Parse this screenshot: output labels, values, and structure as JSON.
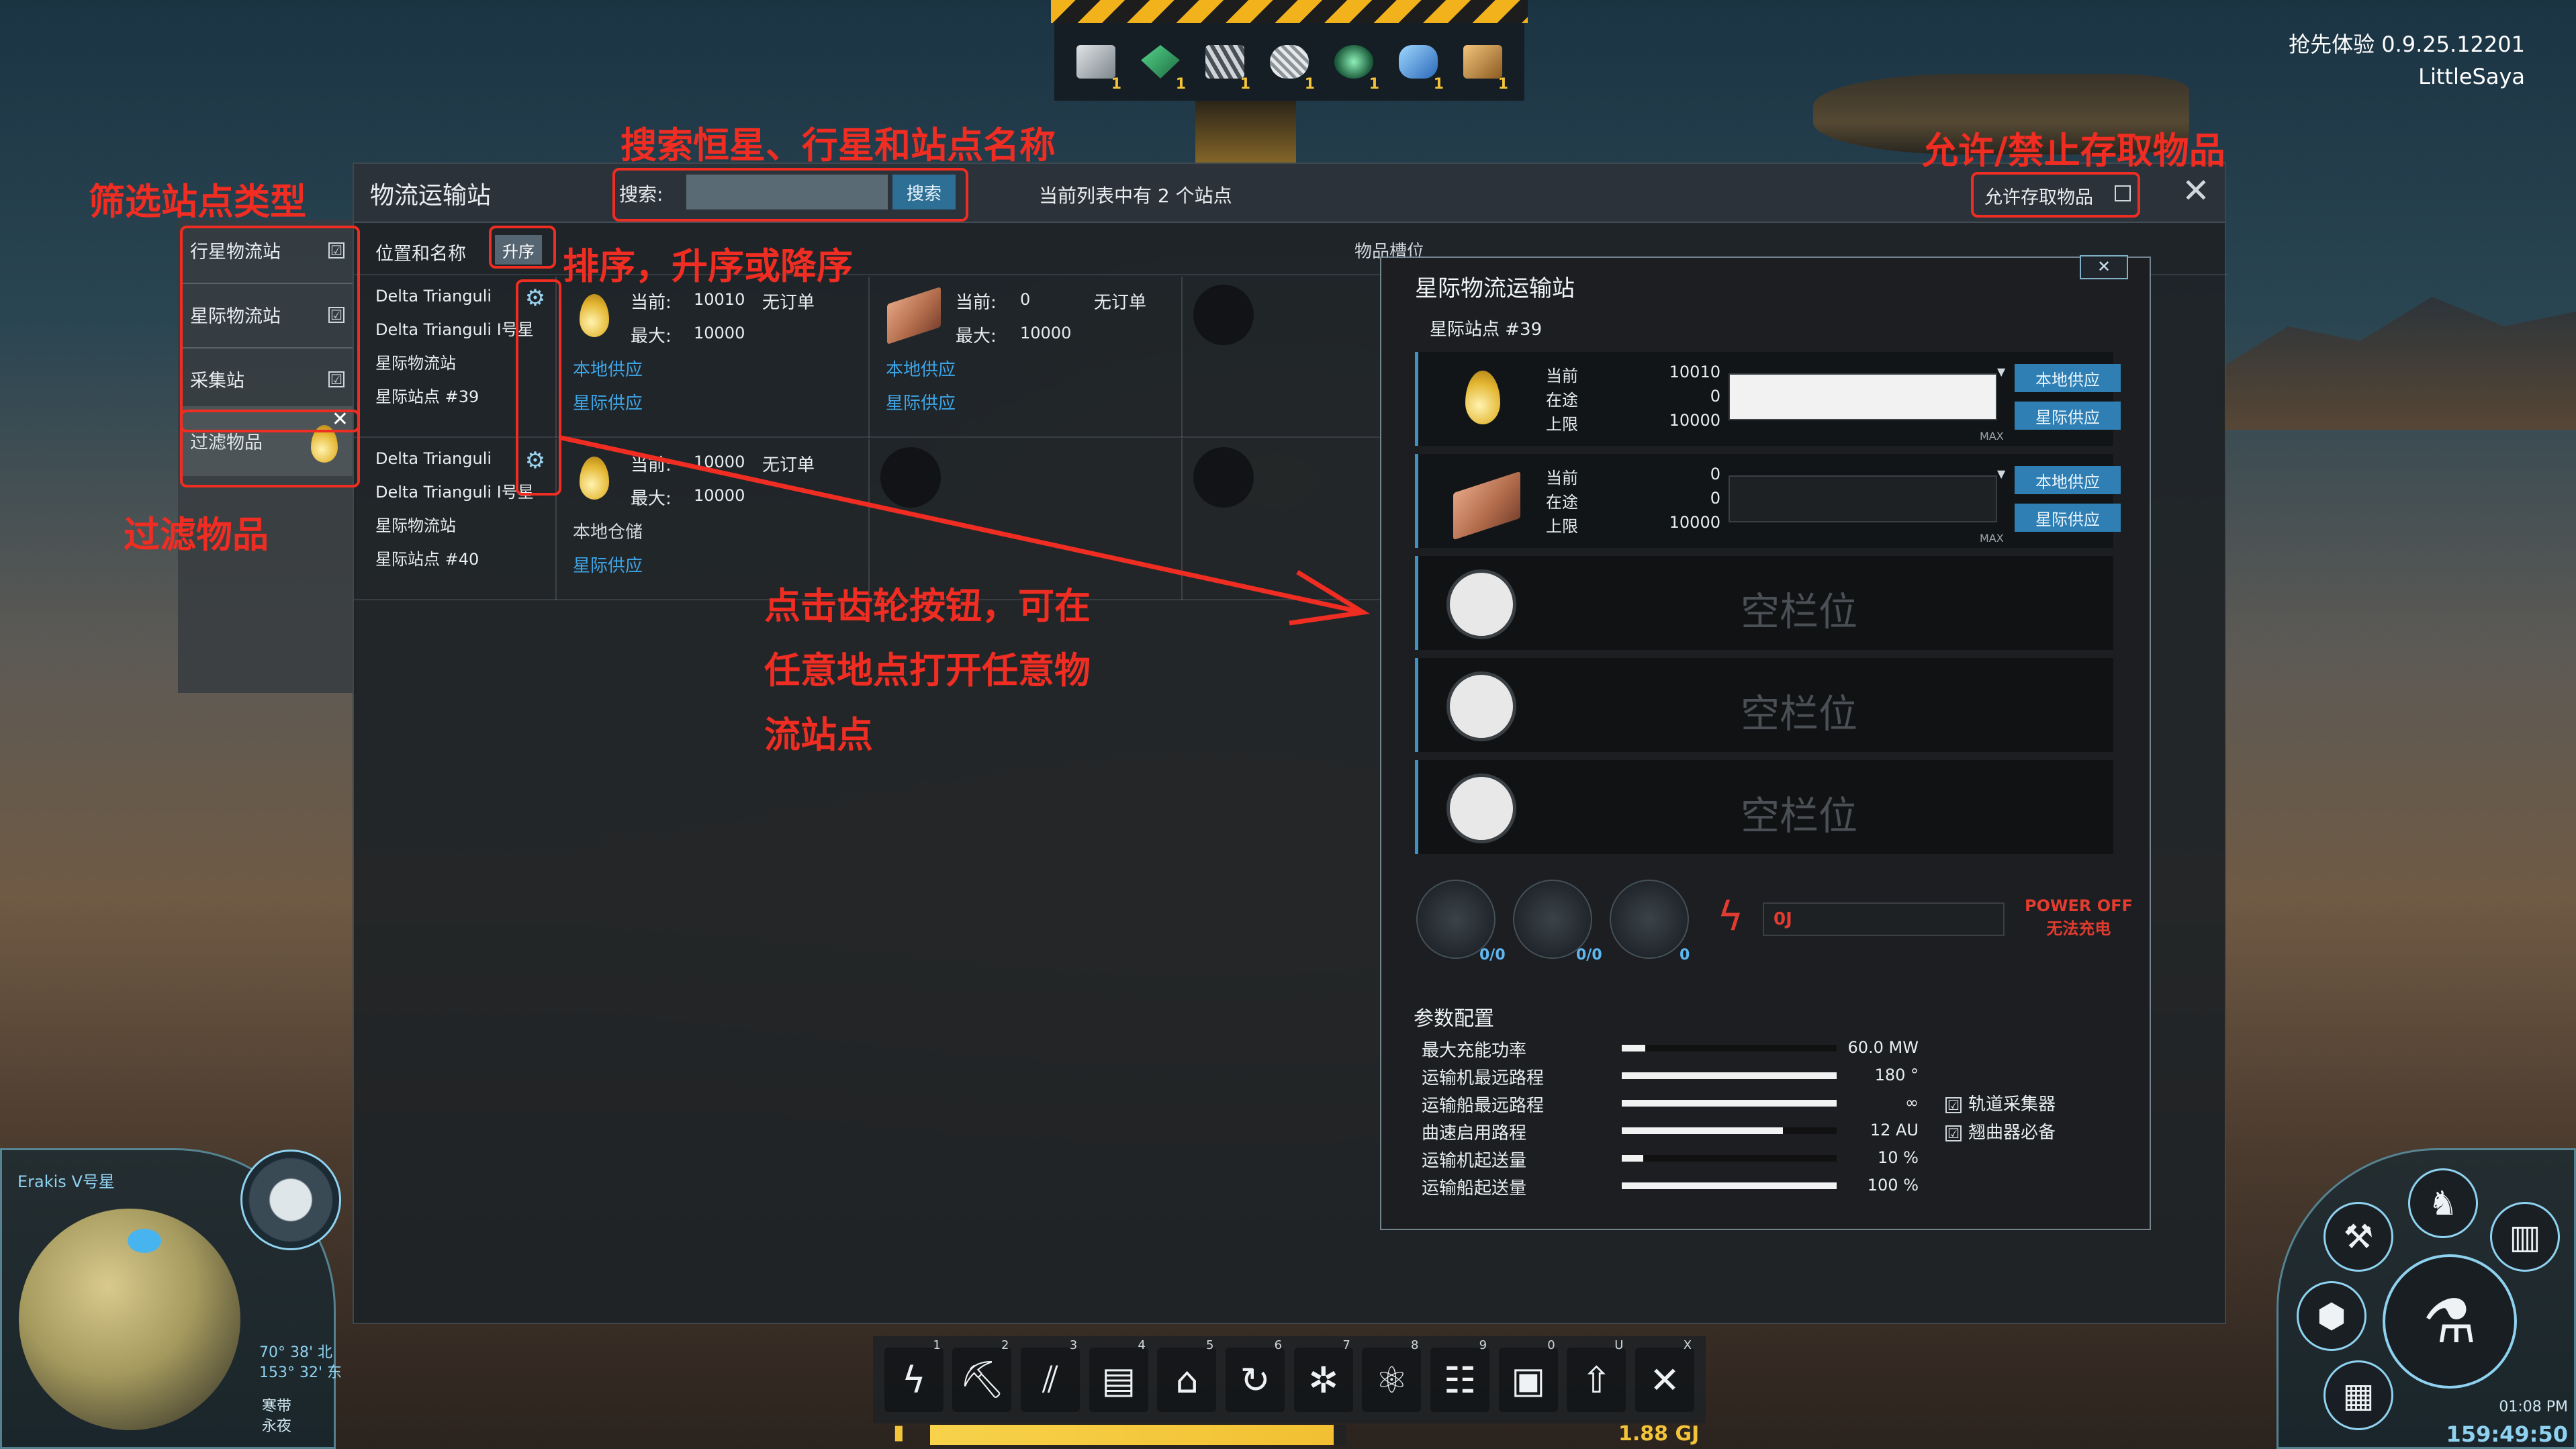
{
  "version": {
    "line1": "抢先体验 0.9.25.12201",
    "line2": "LittleSaya"
  },
  "hotbar": {
    "counts": [
      "1",
      "1",
      "1",
      "1",
      "1",
      "1",
      "1"
    ]
  },
  "window": {
    "title": "物流运输站",
    "search_label": "搜索:",
    "search_value": "",
    "search_button": "搜索",
    "list_count": "当前列表中有 2 个站点",
    "allow_label": "允许存取物品",
    "close": "✕"
  },
  "filter": {
    "items": [
      {
        "label": "行星物流站",
        "checked": "☑"
      },
      {
        "label": "星际物流站",
        "checked": "☑"
      },
      {
        "label": "采集站",
        "checked": "☑"
      }
    ],
    "filter_item_label": "过滤物品",
    "filter_item_remove": "✕"
  },
  "list": {
    "header_label": "位置和名称",
    "sort_button": "升序",
    "slot_header": "物品槽位",
    "stations": [
      {
        "star": "Delta Trianguli",
        "planet": "Delta Trianguli I号星",
        "type": "星际物流站",
        "name": "星际站点 #39",
        "items": [
          {
            "current_k": "当前:",
            "current_v": "10010",
            "order": "无订单",
            "max_k": "最大:",
            "max_v": "10000",
            "local": "本地供应",
            "remote": "星际供应"
          },
          {
            "current_k": "当前:",
            "current_v": "0",
            "order": "无订单",
            "max_k": "最大:",
            "max_v": "10000",
            "local": "本地供应",
            "remote": "星际供应"
          }
        ]
      },
      {
        "star": "Delta Trianguli",
        "planet": "Delta Trianguli I号星",
        "type": "星际物流站",
        "name": "星际站点 #40",
        "items": [
          {
            "current_k": "当前:",
            "current_v": "10000",
            "order": "无订单",
            "max_k": "最大:",
            "max_v": "10000",
            "local": "本地仓储",
            "remote": "星际供应"
          }
        ]
      }
    ]
  },
  "detail": {
    "title": "星际物流运输站",
    "close": "✕",
    "subtitle": "星际站点 #39",
    "slots": [
      {
        "k1": "当前",
        "v1": "10010",
        "k2": "在途",
        "v2": "0",
        "k3": "上限",
        "v3": "10000",
        "fill": 1.0,
        "max": "MAX",
        "btn1": "本地供应",
        "btn2": "星际供应"
      },
      {
        "k1": "当前",
        "v1": "0",
        "k2": "在途",
        "v2": "0",
        "k3": "上限",
        "v3": "10000",
        "fill": 0.0,
        "max": "MAX",
        "btn1": "本地供应",
        "btn2": "星际供应"
      }
    ],
    "empty_slot_label": "空栏位",
    "vessels": {
      "drones": "0/0",
      "ships": "0/0",
      "warpers": "0"
    },
    "power_value": "0J",
    "power_off_en": "POWER OFF",
    "power_off_cn": "无法充电",
    "params_title": "参数配置",
    "params": [
      {
        "label": "最大充能功率",
        "value": "60.0 MW",
        "fill": 0.11
      },
      {
        "label": "运输机最远路程",
        "value": "180 °",
        "fill": 1.0
      },
      {
        "label": "运输船最远路程",
        "value": "∞",
        "fill": 1.0
      },
      {
        "label": "曲速启用路程",
        "value": "12 AU",
        "fill": 0.75
      },
      {
        "label": "运输机起送量",
        "value": "10 %",
        "fill": 0.1
      },
      {
        "label": "运输船起送量",
        "value": "100 %",
        "fill": 1.0
      }
    ],
    "checks": [
      {
        "box": "☑",
        "label": "轨道采集器"
      },
      {
        "box": "☑",
        "label": "翘曲器必备"
      }
    ]
  },
  "annotations": {
    "filter_type": "筛选站点类型",
    "search_hint": "搜索恒星、行星和站点名称",
    "allow_hint": "允许/禁止存取物品",
    "sort_hint": "排序，升序或降序",
    "filter_item": "过滤物品",
    "gear_hint_1": "点击齿轮按钮，可在",
    "gear_hint_2": "任意地点打开任意物",
    "gear_hint_3": "流站点"
  },
  "bottombar": {
    "keys": [
      "1",
      "2",
      "3",
      "4",
      "5",
      "6",
      "7",
      "8",
      "9",
      "0",
      "U",
      "X"
    ],
    "energy": "1.88 GJ"
  },
  "minimap": {
    "planet_name": "Erakis V号星",
    "coord1": "70° 38' 北",
    "coord2": "153° 32' 东",
    "season1": "寒带",
    "season2": "永夜"
  },
  "clock": {
    "time": "01:08 PM",
    "elapsed": "159:49:50"
  }
}
